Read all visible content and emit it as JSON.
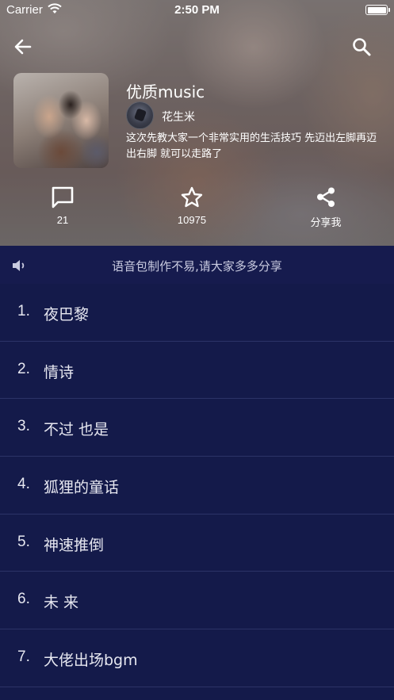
{
  "status_bar": {
    "carrier": "Carrier",
    "time": "2:50 PM"
  },
  "header": {
    "back_icon": "arrow-left-icon",
    "search_icon": "search-icon"
  },
  "album": {
    "title": "优质music",
    "author": "花生米",
    "description": "这次先教大家一个非常实用的生活技巧 先迈出左脚再迈出右脚 就可以走路了"
  },
  "actions": {
    "comments": {
      "icon": "comment-icon",
      "count": "21"
    },
    "favorites": {
      "icon": "star-icon",
      "count": "10975"
    },
    "share": {
      "icon": "share-icon",
      "label": "分享我"
    }
  },
  "notice": {
    "icon": "speaker-icon",
    "text": "语音包制作不易,请大家多多分享"
  },
  "tracks": [
    {
      "num": "1.",
      "name": "夜巴黎"
    },
    {
      "num": "2.",
      "name": "情诗"
    },
    {
      "num": "3.",
      "name": "不过 也是"
    },
    {
      "num": "4.",
      "name": "狐狸的童话"
    },
    {
      "num": "5.",
      "name": "神速推倒"
    },
    {
      "num": "6.",
      "name": "未 来"
    },
    {
      "num": "7.",
      "name": "大佬出场bgm"
    }
  ],
  "colors": {
    "list_background": "#141a4a",
    "divider": "#2c3367",
    "text": "#e6e7f0"
  }
}
